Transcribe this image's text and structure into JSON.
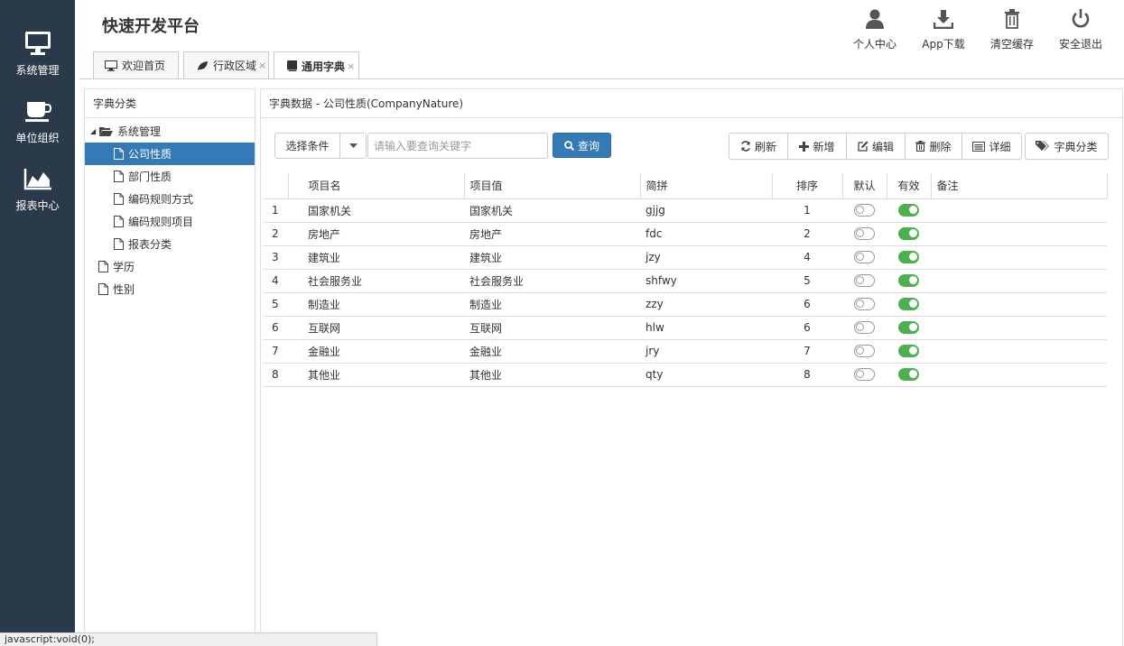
{
  "app": {
    "title": "快速开发平台"
  },
  "leftnav": [
    {
      "label": "系统管理",
      "icon": "monitor-icon"
    },
    {
      "label": "单位组织",
      "icon": "coffee-cup-icon"
    },
    {
      "label": "报表中心",
      "icon": "area-chart-icon"
    }
  ],
  "header_actions": [
    {
      "label": "个人中心",
      "icon": "user-icon"
    },
    {
      "label": "App下载",
      "icon": "download-icon"
    },
    {
      "label": "清空缓存",
      "icon": "trash-icon"
    },
    {
      "label": "安全退出",
      "icon": "power-icon"
    }
  ],
  "tabs": [
    {
      "label": "欢迎首页",
      "icon": "monitor-icon",
      "closable": false
    },
    {
      "label": "行政区域",
      "icon": "leaf-icon",
      "closable": true,
      "close": "×"
    },
    {
      "label": "通用字典",
      "icon": "book-icon",
      "closable": true,
      "close": "×",
      "active": true
    }
  ],
  "tree": {
    "title": "字典分类",
    "nodes": [
      {
        "label": "系统管理",
        "level": 0,
        "expanded": true,
        "expander": "◢"
      },
      {
        "label": "公司性质",
        "level": 1,
        "selected": true
      },
      {
        "label": "部门性质",
        "level": 1
      },
      {
        "label": "编码规则方式",
        "level": 1
      },
      {
        "label": "编码规则项目",
        "level": 1
      },
      {
        "label": "报表分类",
        "level": 1
      },
      {
        "label": "学历",
        "level": 0
      },
      {
        "label": "性别",
        "level": 0
      }
    ]
  },
  "data_panel": {
    "title": "字典数据 - 公司性质(CompanyNature)",
    "select_condition": "选择条件",
    "search_placeholder": "请输入要查询关键字",
    "query_button": "查询",
    "buttons": [
      {
        "label": "刷新",
        "icon": "refresh-icon"
      },
      {
        "label": "新增",
        "icon": "plus-icon"
      },
      {
        "label": "编辑",
        "icon": "edit-icon"
      },
      {
        "label": "删除",
        "icon": "trash-icon"
      },
      {
        "label": "详细",
        "icon": "list-icon"
      }
    ],
    "category_button": "字典分类"
  },
  "table": {
    "columns": [
      "",
      "项目名",
      "项目值",
      "简拼",
      "排序",
      "默认",
      "有效",
      "备注"
    ],
    "rows": [
      {
        "no": "1",
        "name": "国家机关",
        "value": "国家机关",
        "pinyin": "gjjg",
        "sort": "1",
        "default": false,
        "valid": true,
        "note": ""
      },
      {
        "no": "2",
        "name": "房地产",
        "value": "房地产",
        "pinyin": "fdc",
        "sort": "2",
        "default": false,
        "valid": true,
        "note": ""
      },
      {
        "no": "3",
        "name": "建筑业",
        "value": "建筑业",
        "pinyin": "jzy",
        "sort": "4",
        "default": false,
        "valid": true,
        "note": ""
      },
      {
        "no": "4",
        "name": "社会服务业",
        "value": "社会服务业",
        "pinyin": "shfwy",
        "sort": "5",
        "default": false,
        "valid": true,
        "note": ""
      },
      {
        "no": "5",
        "name": "制造业",
        "value": "制造业",
        "pinyin": "zzy",
        "sort": "6",
        "default": false,
        "valid": true,
        "note": ""
      },
      {
        "no": "6",
        "name": "互联网",
        "value": "互联网",
        "pinyin": "hlw",
        "sort": "6",
        "default": false,
        "valid": true,
        "note": ""
      },
      {
        "no": "7",
        "name": "金融业",
        "value": "金融业",
        "pinyin": "jry",
        "sort": "7",
        "default": false,
        "valid": true,
        "note": ""
      },
      {
        "no": "8",
        "name": "其他业",
        "value": "其他业",
        "pinyin": "qty",
        "sort": "8",
        "default": false,
        "valid": true,
        "note": ""
      }
    ]
  },
  "statusbar": {
    "text": "javascript:void(0);"
  },
  "colors": {
    "nav_bg": "#2b3a4a",
    "primary": "#337ab7",
    "switch_on": "#4caf50"
  }
}
